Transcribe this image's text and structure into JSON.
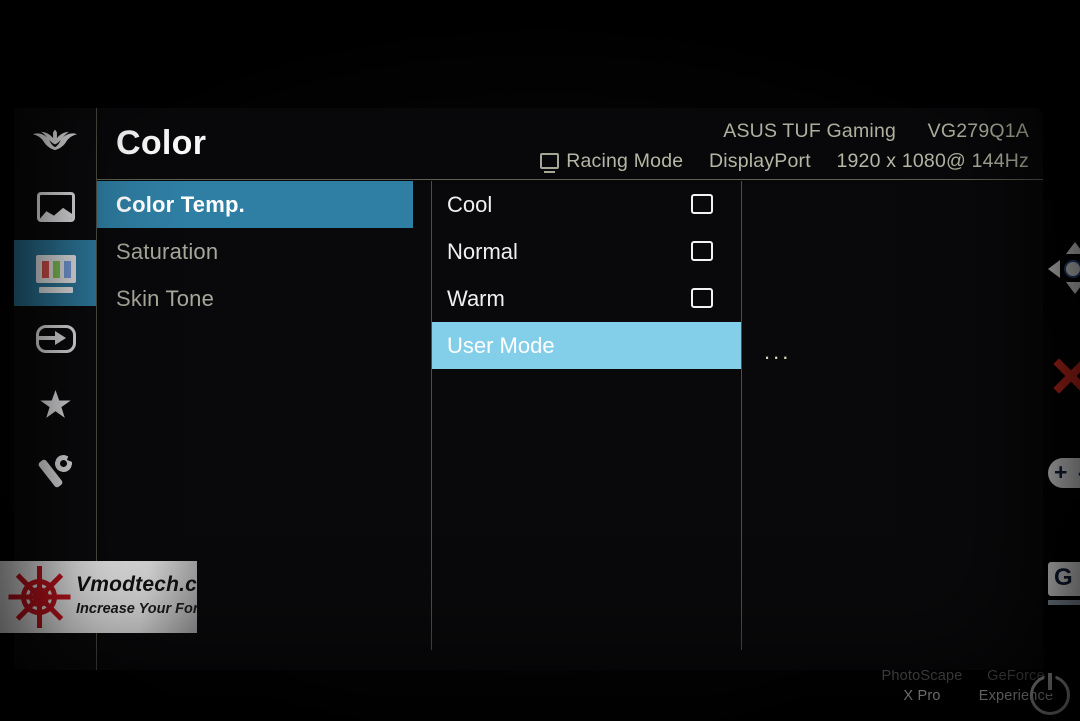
{
  "osd": {
    "title": "Color",
    "header": {
      "preset_icon": "monitor-icon",
      "preset_mode": "Racing Mode",
      "brand": "ASUS TUF Gaming",
      "model": "VG279Q1A",
      "input_source": "DisplayPort",
      "resolution": "1920 x 1080@ 144Hz"
    },
    "sidebar": [
      {
        "name": "tuf-logo",
        "icon": "tuf-wing-icon",
        "active": false
      },
      {
        "name": "gaming-image",
        "icon": "picture-icon",
        "active": false
      },
      {
        "name": "color",
        "icon": "color-bars-icon",
        "active": true
      },
      {
        "name": "input-select",
        "icon": "input-arrow-icon",
        "active": false
      },
      {
        "name": "my-favorite",
        "icon": "star-icon",
        "active": false
      },
      {
        "name": "system-setup",
        "icon": "wrench-icon",
        "active": false
      }
    ],
    "menu": [
      {
        "label": "Color Temp.",
        "selected": true
      },
      {
        "label": "Saturation",
        "selected": false
      },
      {
        "label": "Skin Tone",
        "selected": false
      }
    ],
    "options": [
      {
        "label": "Cool",
        "selected": false,
        "checked": false
      },
      {
        "label": "Normal",
        "selected": false,
        "checked": false
      },
      {
        "label": "Warm",
        "selected": false,
        "checked": false
      },
      {
        "label": "User Mode",
        "selected": true,
        "checked": false
      }
    ],
    "submenu_indicator": "...",
    "colors": {
      "menu_highlight": "#2f7ea3",
      "option_highlight": "#83cfea",
      "panel_background": "#09090b",
      "divider": "#4d4f44",
      "meta_text": "#b9b9a8"
    }
  },
  "controls": [
    {
      "name": "navigation-dpad",
      "icon": "dpad-icon",
      "label": ""
    },
    {
      "name": "close",
      "icon": "close-x-icon",
      "label": ""
    },
    {
      "name": "plus-minus",
      "icon": "plus-minus-icon",
      "label": "+ -"
    },
    {
      "name": "gamevisual",
      "icon": "g-badge-icon",
      "label": "G"
    }
  ],
  "desktop": {
    "icons": [
      {
        "name": "photoscape-x-pro",
        "line1": "PhotoScape",
        "line2": "X Pro"
      },
      {
        "name": "geforce-experience",
        "line1": "GeForce",
        "line2": "Experience"
      }
    ],
    "power_button": "power-icon"
  },
  "watermark": {
    "title": "Vmodtech.com",
    "tagline": "Increase Your Force"
  }
}
